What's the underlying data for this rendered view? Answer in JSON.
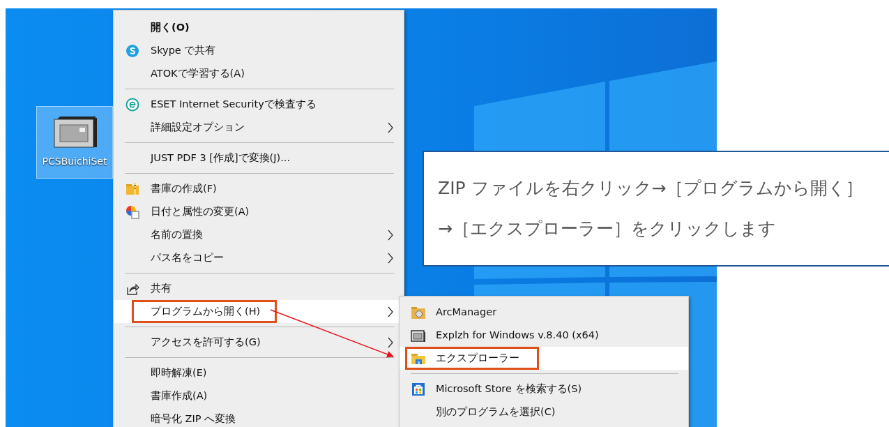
{
  "desktop": {
    "icon": {
      "label": "PCSBuichiSet",
      "selected": true
    }
  },
  "context_menu": {
    "items": [
      {
        "kind": "item",
        "label": "開く(O)",
        "default": true,
        "selected": false,
        "submenu": false,
        "marked": false
      },
      {
        "kind": "item",
        "label": "Skype で共有",
        "default": false,
        "selected": false,
        "submenu": false,
        "marked": false
      },
      {
        "kind": "item",
        "label": "ATOKで学習する(A)",
        "default": false,
        "selected": false,
        "submenu": false,
        "marked": false
      },
      {
        "kind": "separator"
      },
      {
        "kind": "item",
        "label": "ESET Internet Securityで検査する",
        "default": false,
        "selected": false,
        "submenu": false,
        "marked": false
      },
      {
        "kind": "item",
        "label": "詳細設定オプション",
        "default": false,
        "selected": false,
        "submenu": true,
        "marked": false
      },
      {
        "kind": "separator"
      },
      {
        "kind": "item",
        "label": "JUST PDF 3 [作成]で変換(J)...",
        "default": false,
        "selected": false,
        "submenu": false,
        "marked": false
      },
      {
        "kind": "separator"
      },
      {
        "kind": "item",
        "label": "書庫の作成(F)",
        "default": false,
        "selected": false,
        "submenu": false,
        "marked": false
      },
      {
        "kind": "item",
        "label": "日付と属性の変更(A)",
        "default": false,
        "selected": false,
        "submenu": false,
        "marked": false
      },
      {
        "kind": "item",
        "label": "名前の置換",
        "default": false,
        "selected": false,
        "submenu": true,
        "marked": false
      },
      {
        "kind": "item",
        "label": "パス名をコピー",
        "default": false,
        "selected": false,
        "submenu": true,
        "marked": false
      },
      {
        "kind": "separator"
      },
      {
        "kind": "item",
        "label": "共有",
        "default": false,
        "selected": false,
        "submenu": false,
        "marked": false
      },
      {
        "kind": "item",
        "label": "プログラムから開く(H)",
        "default": false,
        "selected": true,
        "submenu": true,
        "marked": true
      },
      {
        "kind": "separator"
      },
      {
        "kind": "item",
        "label": "アクセスを許可する(G)",
        "default": false,
        "selected": false,
        "submenu": true,
        "marked": false
      },
      {
        "kind": "separator"
      },
      {
        "kind": "item",
        "label": "即時解凍(E)",
        "default": false,
        "selected": false,
        "submenu": false,
        "marked": false
      },
      {
        "kind": "item",
        "label": "書庫作成(A)",
        "default": false,
        "selected": false,
        "submenu": false,
        "marked": false
      },
      {
        "kind": "item",
        "label": "暗号化 ZIP へ変換",
        "default": false,
        "selected": false,
        "submenu": false,
        "marked": false
      }
    ]
  },
  "open_with_menu": {
    "items": [
      {
        "kind": "item",
        "label": "ArcManager",
        "selected": false,
        "marked": false
      },
      {
        "kind": "item",
        "label": "Explzh for Windows v.8.40 (x64)",
        "selected": false,
        "marked": false
      },
      {
        "kind": "item",
        "label": "エクスプローラー",
        "selected": true,
        "marked": true
      },
      {
        "kind": "separator"
      },
      {
        "kind": "item",
        "label": "Microsoft Store を検索する(S)",
        "selected": false,
        "marked": false
      },
      {
        "kind": "item",
        "label": "別のプログラムを選択(C)",
        "selected": false,
        "marked": false
      }
    ]
  },
  "callout": {
    "lines": [
      "ZIP ファイルを右クリック→［プログラムから開く］",
      "→［エクスプローラー］をクリックします"
    ]
  }
}
